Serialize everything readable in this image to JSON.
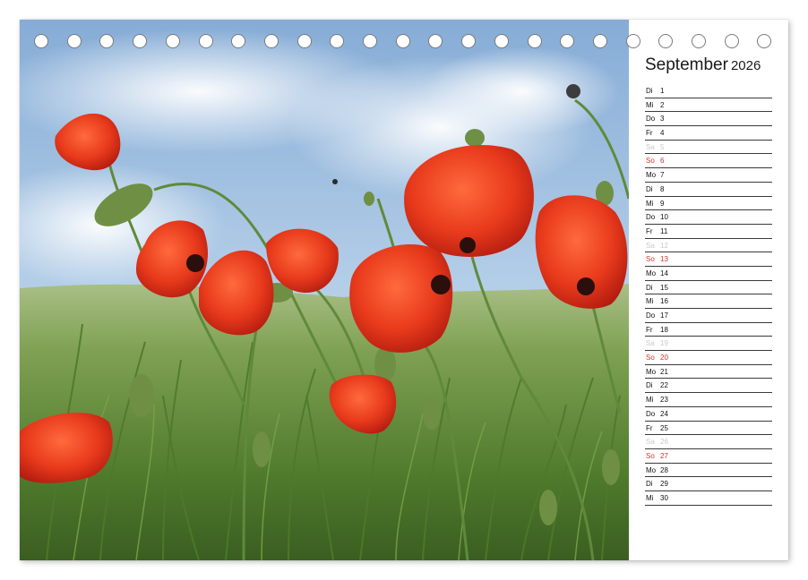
{
  "calendar": {
    "month": "September",
    "year": "2026",
    "days": [
      {
        "wd": "Di",
        "n": "1",
        "type": "weekday"
      },
      {
        "wd": "Mi",
        "n": "2",
        "type": "weekday"
      },
      {
        "wd": "Do",
        "n": "3",
        "type": "weekday"
      },
      {
        "wd": "Fr",
        "n": "4",
        "type": "weekday"
      },
      {
        "wd": "Sa",
        "n": "5",
        "type": "saturday"
      },
      {
        "wd": "So",
        "n": "6",
        "type": "sunday"
      },
      {
        "wd": "Mo",
        "n": "7",
        "type": "weekday"
      },
      {
        "wd": "Di",
        "n": "8",
        "type": "weekday"
      },
      {
        "wd": "Mi",
        "n": "9",
        "type": "weekday"
      },
      {
        "wd": "Do",
        "n": "10",
        "type": "weekday"
      },
      {
        "wd": "Fr",
        "n": "11",
        "type": "weekday"
      },
      {
        "wd": "Sa",
        "n": "12",
        "type": "saturday"
      },
      {
        "wd": "So",
        "n": "13",
        "type": "sunday"
      },
      {
        "wd": "Mo",
        "n": "14",
        "type": "weekday"
      },
      {
        "wd": "Di",
        "n": "15",
        "type": "weekday"
      },
      {
        "wd": "Mi",
        "n": "16",
        "type": "weekday"
      },
      {
        "wd": "Do",
        "n": "17",
        "type": "weekday"
      },
      {
        "wd": "Fr",
        "n": "18",
        "type": "weekday"
      },
      {
        "wd": "Sa",
        "n": "19",
        "type": "saturday"
      },
      {
        "wd": "So",
        "n": "20",
        "type": "sunday"
      },
      {
        "wd": "Mo",
        "n": "21",
        "type": "weekday"
      },
      {
        "wd": "Di",
        "n": "22",
        "type": "weekday"
      },
      {
        "wd": "Mi",
        "n": "23",
        "type": "weekday"
      },
      {
        "wd": "Do",
        "n": "24",
        "type": "weekday"
      },
      {
        "wd": "Fr",
        "n": "25",
        "type": "weekday"
      },
      {
        "wd": "Sa",
        "n": "26",
        "type": "saturday"
      },
      {
        "wd": "So",
        "n": "27",
        "type": "sunday"
      },
      {
        "wd": "Mo",
        "n": "28",
        "type": "weekday"
      },
      {
        "wd": "Di",
        "n": "29",
        "type": "weekday"
      },
      {
        "wd": "Mi",
        "n": "30",
        "type": "weekday"
      }
    ]
  },
  "binding": {
    "ring_count": 23,
    "ring_icon": "binding-ring-icon"
  },
  "photo": {
    "subject_icon": "poppy-field-photo"
  },
  "colors": {
    "sunday": "#d6312b",
    "saturday": "#c9c9c9",
    "poppy": "#e8321c",
    "sky": "#9cc0e2",
    "grass": "#5f8a3a"
  }
}
